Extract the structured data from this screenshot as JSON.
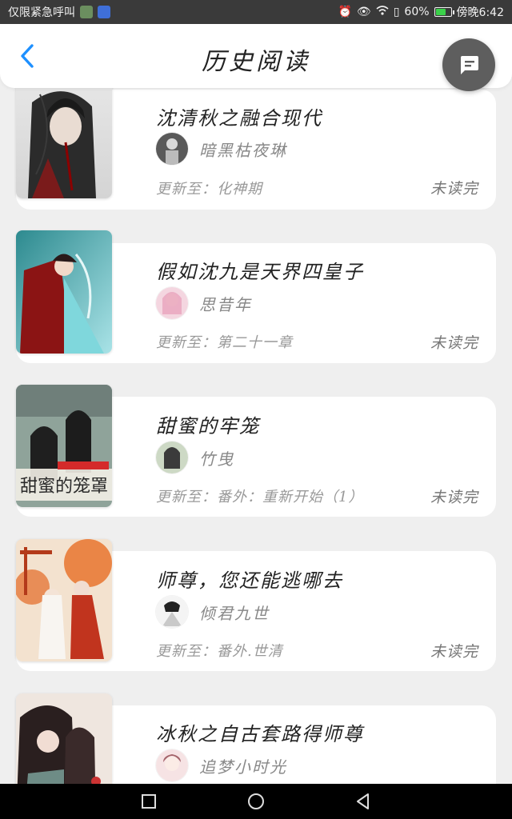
{
  "status_bar": {
    "left_text": "仅限紧急呼叫",
    "battery": "60%",
    "time": "傍晚6:42",
    "battery_level": 0.6
  },
  "header": {
    "title": "历史阅读",
    "back_icon": "chevron-left-icon",
    "chat_icon": "chat-bubble-icon"
  },
  "colors": {
    "accent": "#1e90ff",
    "background": "#efefef",
    "card": "#ffffff"
  },
  "books": [
    {
      "title": "沈清秋之融合现代",
      "author": "暗黑枯夜琳",
      "update": "更新至：化神期",
      "status": "未读完"
    },
    {
      "title": "假如沈九是天界四皇子",
      "author": "思昔年",
      "update": "更新至：第二十一章",
      "status": "未读完"
    },
    {
      "title": "甜蜜的牢笼",
      "author": "竹曳",
      "update": "更新至：番外：重新开始（1）",
      "status": "未读完"
    },
    {
      "title": "师尊，您还能逃哪去",
      "author": "倾君九世",
      "update": "更新至：番外.世清",
      "status": "未读完"
    },
    {
      "title": "冰秋之自古套路得师尊",
      "author": "追梦小时光",
      "update": "",
      "status": ""
    }
  ],
  "nav": {
    "recents_icon": "square-icon",
    "home_icon": "circle-icon",
    "back_icon": "triangle-back-icon"
  }
}
